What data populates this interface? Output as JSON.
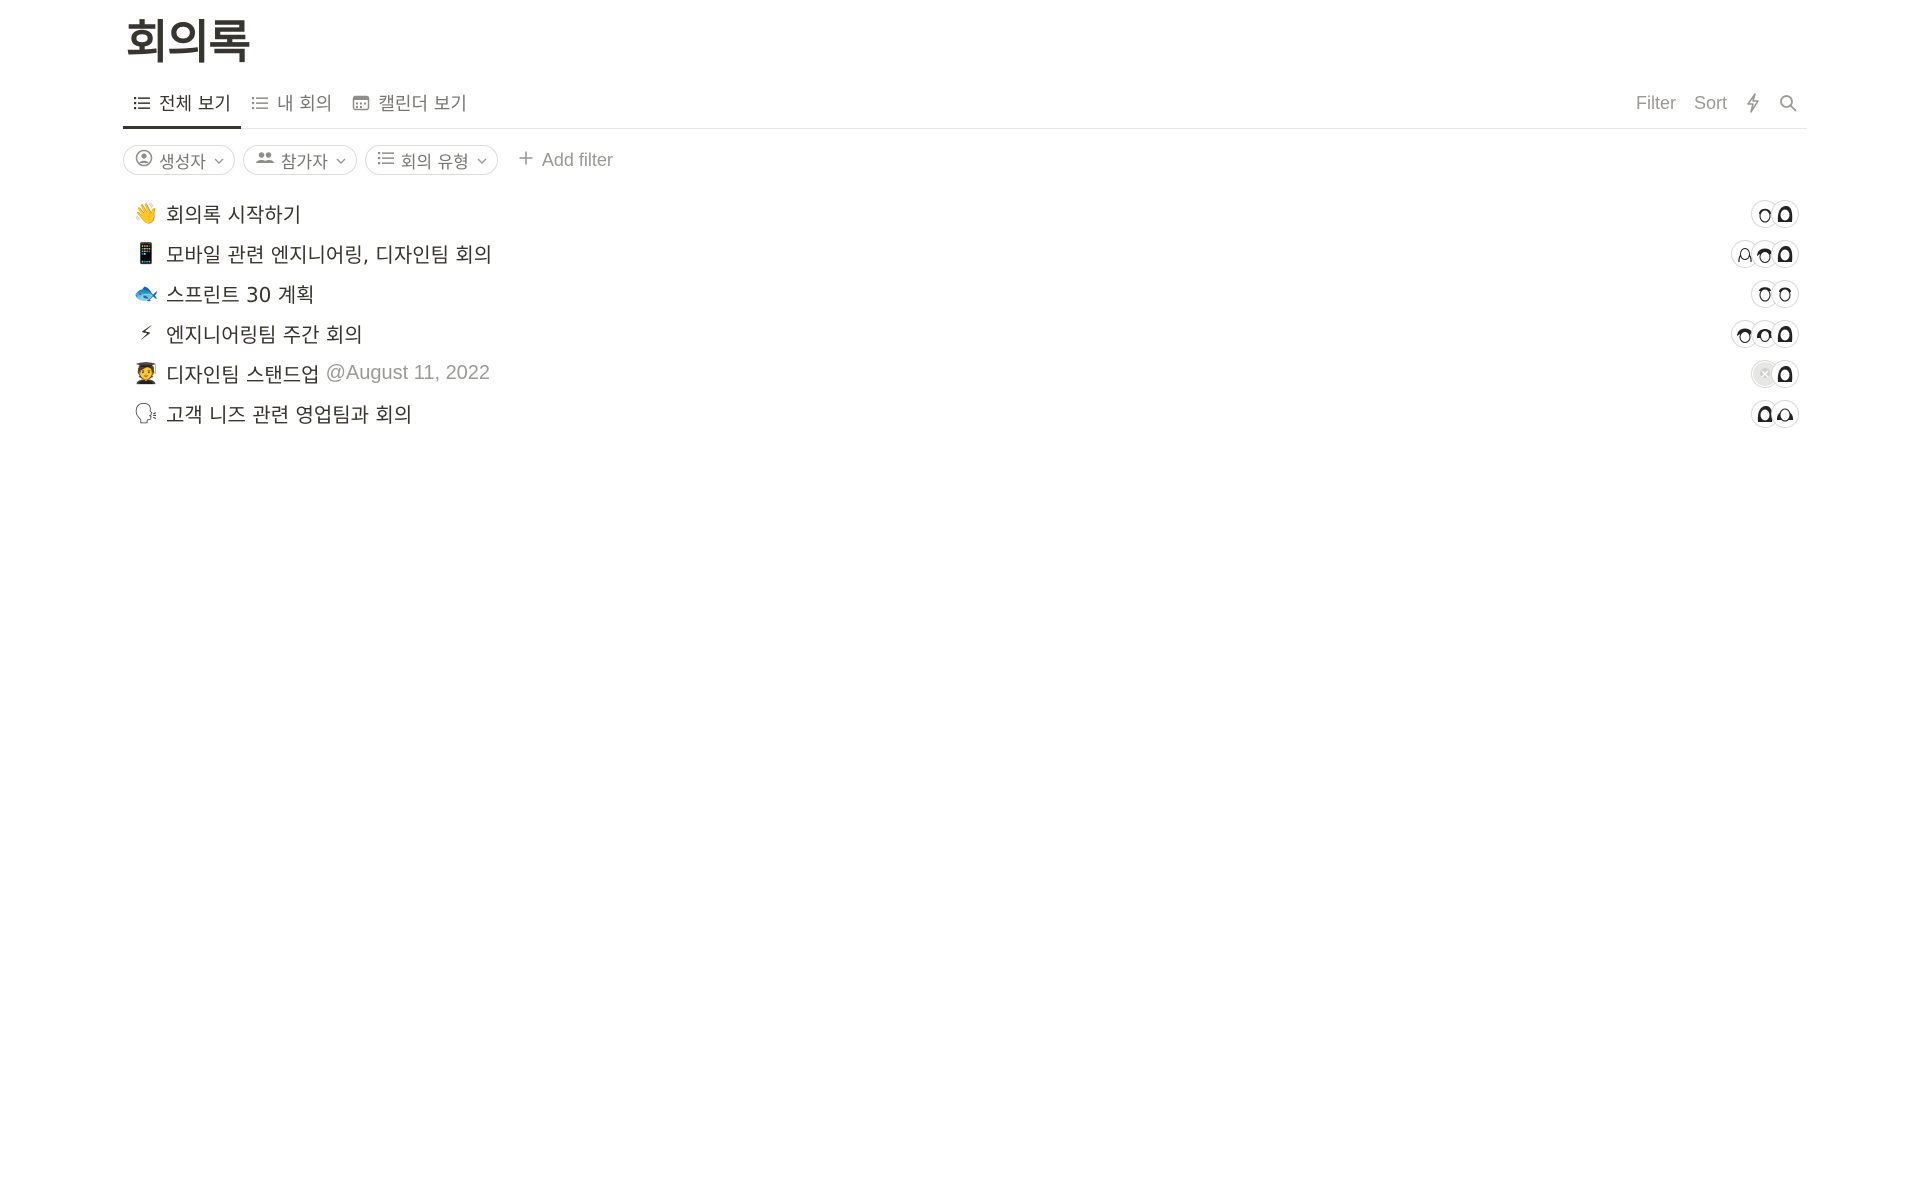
{
  "page": {
    "title": "회의록"
  },
  "tabs": [
    {
      "label": "전체 보기",
      "icon": "list-icon",
      "active": true
    },
    {
      "label": "내 회의",
      "icon": "list-icon",
      "active": false
    },
    {
      "label": "캘린더 보기",
      "icon": "calendar-icon",
      "active": false
    }
  ],
  "toolbar": {
    "filter_label": "Filter",
    "sort_label": "Sort",
    "automation_icon": "lightning-icon",
    "search_icon": "search-icon"
  },
  "filters": {
    "chips": [
      {
        "label": "생성자",
        "icon": "person-circle-icon"
      },
      {
        "label": "참가자",
        "icon": "people-icon"
      },
      {
        "label": "회의 유형",
        "icon": "list-icon"
      }
    ],
    "add_label": "Add filter"
  },
  "meetings": [
    {
      "emoji": "👋",
      "title": "회의록 시작하기",
      "mention": "",
      "attendees": 2
    },
    {
      "emoji": "📱",
      "title": "모바일 관련 엔지니어링, 디자인팀 회의",
      "mention": "",
      "attendees": 3
    },
    {
      "emoji": "🐟",
      "title": "스프린트 30 계획",
      "mention": "",
      "attendees": 2
    },
    {
      "emoji": "⚡",
      "title": "엔지니어링팀 주간 회의",
      "mention": "",
      "attendees": 3
    },
    {
      "emoji": "🧑‍🎓",
      "title": "디자인팀 스탠드업",
      "mention": "@August 11, 2022",
      "attendees": 2
    },
    {
      "emoji": "🗣",
      "title": "고객 니즈 관련 영업팀과 회의",
      "mention": "",
      "attendees": 2
    }
  ],
  "colors": {
    "text": "#37352f",
    "muted": "#787774",
    "faint": "#9b9a97",
    "border": "#e9e9e7"
  }
}
